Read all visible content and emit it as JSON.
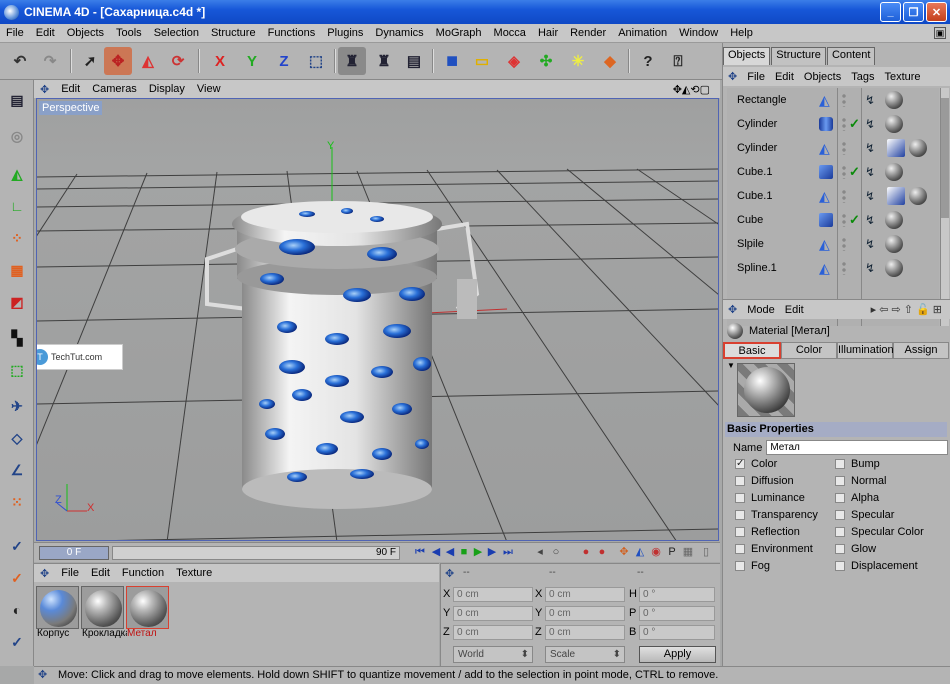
{
  "window": {
    "title": "CINEMA 4D - [Сахарница.c4d *]",
    "min": "_",
    "max": "❐",
    "close": "✕"
  },
  "menu": [
    "File",
    "Edit",
    "Objects",
    "Tools",
    "Selection",
    "Structure",
    "Functions",
    "Plugins",
    "Dynamics",
    "MoGraph",
    "Mocca",
    "Hair",
    "Render",
    "Animation",
    "Window",
    "Help"
  ],
  "viewport": {
    "menu": [
      "Edit",
      "Cameras",
      "Display",
      "View"
    ],
    "label": "Perspective",
    "watermark": "TechTut.com",
    "axis_y": "Y",
    "axis_z": "Z",
    "axis_x": "X"
  },
  "timeline": {
    "current_frame": "0 F",
    "end_frame": "90 F"
  },
  "material_manager": {
    "menu": [
      "File",
      "Edit",
      "Function",
      "Texture"
    ],
    "materials": [
      {
        "label": "Корпус",
        "color": "#000000"
      },
      {
        "label": "Крокладка",
        "color": "#000000"
      },
      {
        "label": "Метал",
        "color": "#c01010"
      }
    ]
  },
  "coordinates": {
    "col_headers": [
      "--",
      "--",
      "--"
    ],
    "rows": [
      {
        "a": "X",
        "av": "0 cm",
        "b": "X",
        "bv": "0 cm",
        "c": "H",
        "cv": "0 °"
      },
      {
        "a": "Y",
        "av": "0 cm",
        "b": "Y",
        "bv": "0 cm",
        "c": "P",
        "cv": "0 °"
      },
      {
        "a": "Z",
        "av": "0 cm",
        "b": "Z",
        "bv": "0 cm",
        "c": "B",
        "cv": "0 °"
      }
    ],
    "mode1": "World",
    "mode2": "Scale",
    "apply": "Apply"
  },
  "status": "Move: Click and drag to move elements. Hold down SHIFT to quantize movement / add to the selection in point mode, CTRL to remove.",
  "objects_panel": {
    "tabs": [
      "Objects",
      "Structure",
      "Content"
    ],
    "menu": [
      "File",
      "Edit",
      "Objects",
      "Tags",
      "Texture"
    ],
    "items": [
      {
        "name": "Rectangle",
        "type": "spline",
        "check": false,
        "tags": 1
      },
      {
        "name": "Cylinder",
        "type": "cylinder",
        "check": true,
        "tags": 1
      },
      {
        "name": "Cylinder",
        "type": "spline",
        "check": false,
        "tags": 2
      },
      {
        "name": "Cube.1",
        "type": "cube",
        "check": true,
        "tags": 1
      },
      {
        "name": "Cube.1",
        "type": "spline",
        "check": false,
        "tags": 2
      },
      {
        "name": "Cube",
        "type": "cube",
        "check": true,
        "tags": 1
      },
      {
        "name": "Slpile",
        "type": "spline",
        "check": false,
        "tags": 1
      },
      {
        "name": "Spline.1",
        "type": "spline",
        "check": false,
        "tags": 1
      }
    ]
  },
  "attributes": {
    "menu": [
      "Mode",
      "Edit"
    ],
    "material_name": "Material [Метал]",
    "tabs": [
      "Basic",
      "Color",
      "Illumination",
      "Assign"
    ],
    "section": "Basic Properties",
    "name_label": "Name",
    "name_value": "Метал",
    "channels_left": [
      {
        "label": "Color",
        "checked": true
      },
      {
        "label": "Diffusion",
        "checked": false
      },
      {
        "label": "Luminance",
        "checked": false
      },
      {
        "label": "Transparency",
        "checked": false
      },
      {
        "label": "Reflection",
        "checked": false
      },
      {
        "label": "Environment",
        "checked": false
      },
      {
        "label": "Fog",
        "checked": false
      }
    ],
    "channels_right": [
      {
        "label": "Bump",
        "checked": false
      },
      {
        "label": "Normal",
        "checked": false
      },
      {
        "label": "Alpha",
        "checked": false
      },
      {
        "label": "Specular",
        "checked": false
      },
      {
        "label": "Specular Color",
        "checked": false
      },
      {
        "label": "Glow",
        "checked": false
      },
      {
        "label": "Displacement",
        "checked": false
      }
    ]
  }
}
